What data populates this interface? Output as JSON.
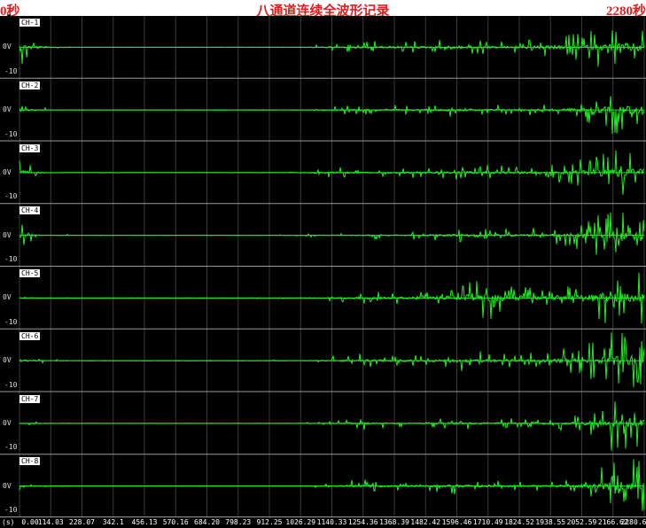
{
  "header": {
    "start_label": "0秒",
    "title": "八通道连续全波形记录",
    "end_label": "2280秒"
  },
  "x_axis": {
    "unit_label": "(s)",
    "ticks": [
      "0.00",
      "114.03",
      "228.07",
      "342.1",
      "456.13",
      "570.16",
      "684.20",
      "798.23",
      "912.25",
      "1026.29",
      "1140.33",
      "1254.36",
      "1368.39",
      "1482.42",
      "1596.46",
      "1710.49",
      "1824.52",
      "1938.55",
      "2052.59",
      "2166.62",
      "2280.6"
    ]
  },
  "channels": [
    {
      "label": "CH-1",
      "unit": "0V",
      "scale": "-10",
      "activity": [
        0.9,
        0.3,
        0.15,
        0.1,
        0.1,
        0.1,
        0.1,
        0.15,
        0.15,
        0.25,
        0.4,
        0.45,
        0.5,
        0.45,
        0.6,
        0.5,
        0.5,
        0.6,
        0.7,
        0.9,
        1.0
      ]
    },
    {
      "label": "CH-2",
      "unit": "0V",
      "scale": "-10",
      "activity": [
        0.6,
        0.2,
        0.15,
        0.1,
        0.1,
        0.1,
        0.1,
        0.1,
        0.15,
        0.2,
        0.35,
        0.45,
        0.4,
        0.4,
        0.5,
        0.45,
        0.45,
        0.5,
        0.65,
        0.9,
        1.0
      ]
    },
    {
      "label": "CH-3",
      "unit": "0V",
      "scale": "-10",
      "activity": [
        0.7,
        0.2,
        0.15,
        0.1,
        0.1,
        0.1,
        0.1,
        0.1,
        0.15,
        0.25,
        0.45,
        0.4,
        0.4,
        0.45,
        0.55,
        0.5,
        0.5,
        0.55,
        0.7,
        1.0,
        0.9
      ]
    },
    {
      "label": "CH-4",
      "unit": "0V",
      "scale": "-10",
      "activity": [
        0.7,
        0.2,
        0.15,
        0.1,
        0.1,
        0.1,
        0.1,
        0.1,
        0.1,
        0.2,
        0.3,
        0.35,
        0.35,
        0.4,
        0.5,
        0.5,
        0.45,
        0.55,
        0.7,
        1.0,
        0.95
      ]
    },
    {
      "label": "CH-5",
      "unit": "0V",
      "scale": "-10",
      "activity": [
        0.3,
        0.15,
        0.1,
        0.1,
        0.1,
        0.1,
        0.1,
        0.1,
        0.15,
        0.2,
        0.35,
        0.55,
        0.45,
        0.5,
        0.8,
        0.9,
        0.75,
        0.6,
        0.85,
        1.0,
        0.95
      ]
    },
    {
      "label": "CH-6",
      "unit": "0V",
      "scale": "-10",
      "activity": [
        0.5,
        0.2,
        0.15,
        0.15,
        0.15,
        0.15,
        0.15,
        0.15,
        0.15,
        0.25,
        0.4,
        0.5,
        0.45,
        0.45,
        0.6,
        0.55,
        0.5,
        0.6,
        0.7,
        1.0,
        0.95
      ]
    },
    {
      "label": "CH-7",
      "unit": "0V",
      "scale": "-10",
      "activity": [
        0.3,
        0.15,
        0.1,
        0.1,
        0.1,
        0.1,
        0.1,
        0.1,
        0.1,
        0.15,
        0.3,
        0.5,
        0.35,
        0.35,
        0.5,
        0.45,
        0.4,
        0.45,
        0.6,
        1.0,
        0.9
      ]
    },
    {
      "label": "CH-8",
      "unit": "0V",
      "scale": "-10",
      "activity": [
        0.4,
        0.15,
        0.1,
        0.1,
        0.1,
        0.1,
        0.1,
        0.1,
        0.1,
        0.15,
        0.3,
        0.55,
        0.4,
        0.4,
        0.55,
        0.45,
        0.4,
        0.45,
        0.6,
        1.0,
        0.95
      ]
    }
  ],
  "colors": {
    "background": "#000000",
    "trace": "#22ee22",
    "grid": "#3a3a3a",
    "title": "#e02020"
  }
}
